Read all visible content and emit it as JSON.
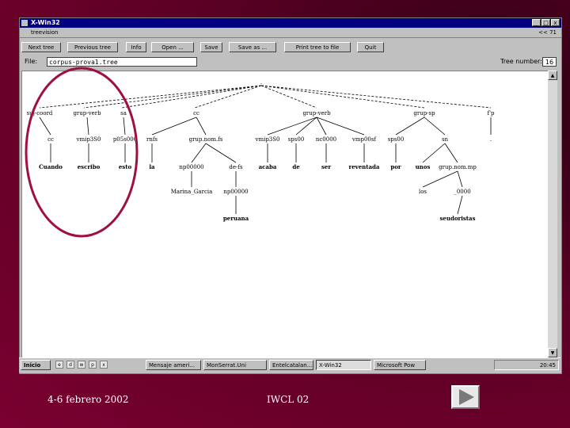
{
  "window": {
    "title": "X-Win32",
    "app_title": "treevision",
    "menu_right": "<< 71",
    "buttons": [
      "_",
      "□",
      "x"
    ]
  },
  "toolbar": {
    "buttons": [
      "Next tree",
      "Previous tree",
      "Info",
      "Open ...",
      "Save",
      "Save as ...",
      "Print tree to file",
      "Quit"
    ]
  },
  "file": {
    "label": "File:",
    "value": "corpus-prova1.tree",
    "tree_label": "Tree number:",
    "tree_value": "16"
  },
  "tree": {
    "level1": [
      "suj-coord",
      "grup-verb",
      "sa",
      "cc",
      "grup-verb",
      "grup-sp",
      "f'p"
    ],
    "level2": [
      "cc",
      "vmip3S0",
      "p05s000",
      "rnfs",
      "grup.nom.fs",
      "vmip3S0",
      "sps00",
      "nc0000",
      "vmp00sf",
      "sps00",
      "sn",
      "."
    ],
    "words": [
      "Cuando",
      "escribo",
      "esto",
      "la",
      "np00000",
      "de-fs",
      "acaba",
      "de",
      "ser",
      "reventada",
      "por",
      "unos",
      "grup.nom.mp"
    ],
    "level4": [
      "Marina_Garcia",
      "np00000",
      "los",
      "_0000"
    ],
    "level5": [
      "peruana",
      "seudoristas"
    ]
  },
  "taskbar": {
    "start": "Inicio",
    "quick": [
      "e",
      "d",
      "w",
      "p",
      "x"
    ],
    "tasks": [
      "Mensaje ameri...",
      "MonSerrat.Uni",
      "Entelcatalan...",
      "X-Win32",
      "Microsoft Pow"
    ],
    "tray": "20:45"
  },
  "footer": {
    "date": "4-6 febrero 2002",
    "conference": "IWCL 02"
  },
  "colors": {
    "background": "#6a0028",
    "highlight_circle": "#a0103c"
  }
}
